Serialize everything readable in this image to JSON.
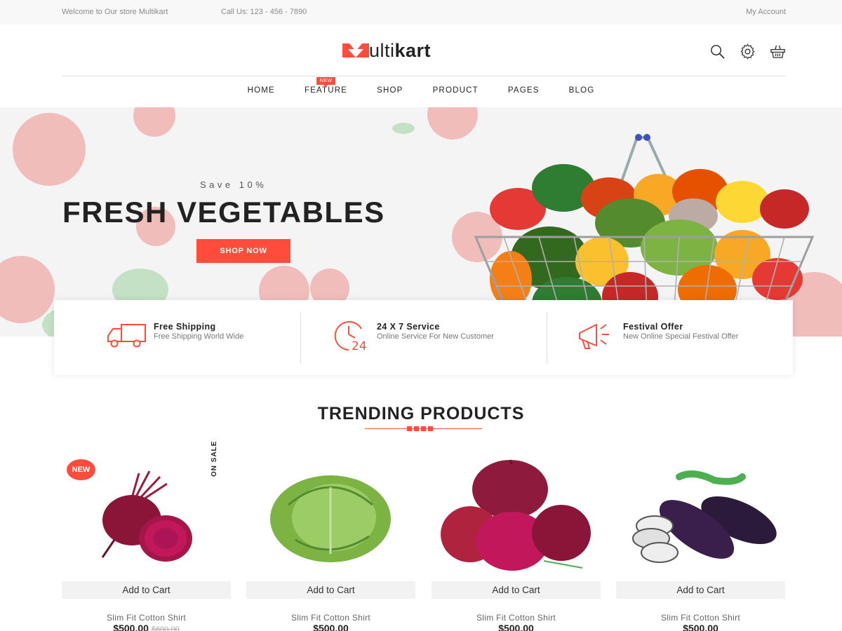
{
  "topbar": {
    "welcome": "Welcome to Our store Multikart",
    "phone": "Call Us: 123 - 456 - 7890",
    "account": "My Account"
  },
  "header": {
    "logo_part1": "ulti",
    "logo_part2": "kart",
    "icons": [
      "search-icon",
      "gear-icon",
      "basket-icon"
    ]
  },
  "nav": {
    "items": [
      {
        "label": "HOME"
      },
      {
        "label": "FEATURE",
        "badge": "NEW"
      },
      {
        "label": "SHOP"
      },
      {
        "label": "PRODUCT"
      },
      {
        "label": "PAGES"
      },
      {
        "label": "BLOG"
      }
    ]
  },
  "hero": {
    "subtitle": "Save 10%",
    "title": "FRESH VEGETABLES",
    "button": "SHOP NOW"
  },
  "services": [
    {
      "icon": "truck-icon",
      "title": "Free Shipping",
      "desc": "Free Shipping World Wide"
    },
    {
      "icon": "clock-24-icon",
      "title": "24 X 7 Service",
      "desc": "Online Service For New Customer"
    },
    {
      "icon": "megaphone-icon",
      "title": "Festival Offer",
      "desc": "New Online Special Festival Offer"
    }
  ],
  "trending": {
    "title": "TRENDING PRODUCTS"
  },
  "products": [
    {
      "image": "beetroot",
      "badge_new": "NEW",
      "badge_sale": "ON SALE",
      "cart": "Add to Cart",
      "name": "Slim Fit Cotton Shirt",
      "price": "$500.00",
      "old_price": "$600.00"
    },
    {
      "image": "cabbage",
      "cart": "Add to Cart",
      "name": "Slim Fit Cotton Shirt",
      "price": "$500.00"
    },
    {
      "image": "onion",
      "cart": "Add to Cart",
      "name": "Slim Fit Cotton Shirt",
      "price": "$500.00"
    },
    {
      "image": "eggplant",
      "cart": "Add to Cart",
      "name": "Slim Fit Cotton Shirt",
      "price": "$500.00"
    }
  ],
  "colors": {
    "accent": "#ff4c3b",
    "text": "#222222",
    "topbar_bg": "#f8f8f8"
  }
}
